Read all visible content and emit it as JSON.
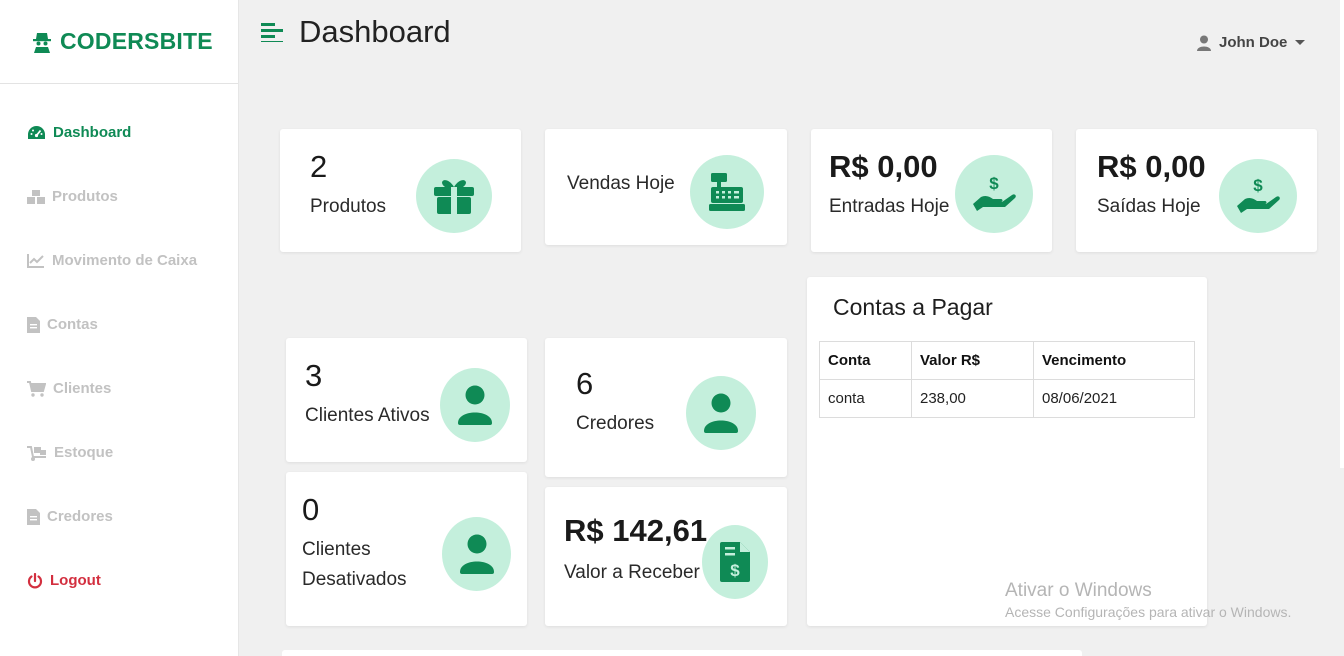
{
  "brand": {
    "name": "CODERSBITE",
    "color": "#0f8a55"
  },
  "sidebar": {
    "items": [
      {
        "label": "Dashboard",
        "icon": "gauge-icon",
        "active": true
      },
      {
        "label": "Produtos",
        "icon": "boxes-icon"
      },
      {
        "label": "Movimento de Caixa",
        "icon": "chart-line-icon"
      },
      {
        "label": "Contas",
        "icon": "file-icon"
      },
      {
        "label": "Clientes",
        "icon": "cart-icon"
      },
      {
        "label": "Estoque",
        "icon": "dolly-icon"
      },
      {
        "label": "Credores",
        "icon": "file-icon"
      },
      {
        "label": "Logout",
        "icon": "power-icon",
        "color": "#d32f3f"
      }
    ]
  },
  "header": {
    "title": "Dashboard",
    "user": "John Doe"
  },
  "cards": {
    "produtos": {
      "value": "2",
      "label": "Produtos",
      "icon": "gift-icon"
    },
    "vendas_hoje": {
      "label": "Vendas Hoje",
      "icon": "cash-register-icon"
    },
    "entradas_hoje": {
      "value": "R$ 0,00",
      "label": "Entradas Hoje",
      "icon": "hand-dollar-icon"
    },
    "saidas_hoje": {
      "value": "R$ 0,00",
      "label": "Saídas Hoje",
      "icon": "hand-dollar-icon"
    },
    "clientes_ativos": {
      "value": "3",
      "label": "Clientes Ativos",
      "icon": "user-icon"
    },
    "credores": {
      "value": "6",
      "label": "Credores",
      "icon": "user-icon"
    },
    "clientes_desativados": {
      "value": "0",
      "label_line1": "Clientes",
      "label_line2": "Desativados",
      "icon": "user-icon"
    },
    "valor_receber": {
      "value": "R$ 142,61",
      "label": "Valor a Receber",
      "icon": "invoice-dollar-icon"
    }
  },
  "contas_pagar": {
    "title": "Contas a Pagar",
    "columns": [
      "Conta",
      "Valor R$",
      "Vencimento"
    ],
    "rows": [
      [
        "conta",
        "238,00",
        "08/06/2021"
      ]
    ]
  },
  "watermark": {
    "title": "Ativar o Windows",
    "subtitle": "Acesse Configurações para ativar o Windows."
  },
  "colors": {
    "accent": "#0f8a55",
    "icon_bg": "#c4efdc",
    "inactive": "#c2c2c2",
    "danger": "#d32f3f",
    "background": "#f0f0f0"
  }
}
